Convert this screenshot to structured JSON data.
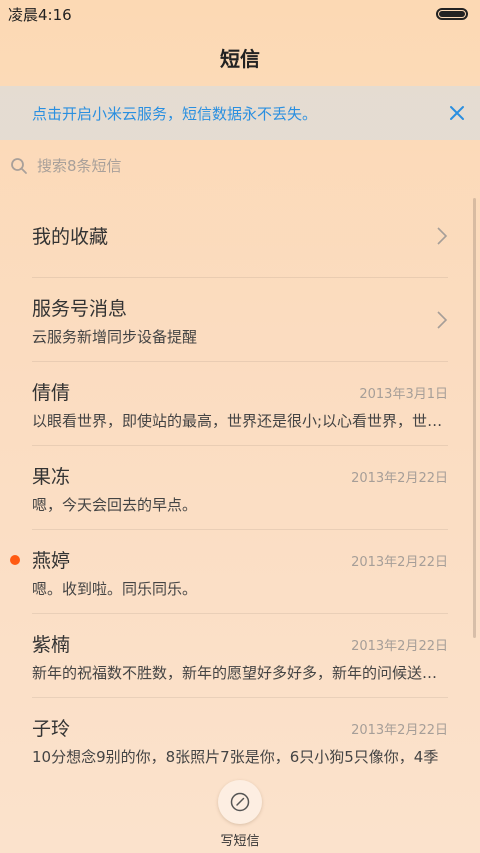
{
  "status_bar": {
    "time": "凌晨4:16",
    "battery_level": 1.0
  },
  "header": {
    "title": "短信"
  },
  "cloud_banner": {
    "text": "点击开启小米云服务，短信数据永不丢失。",
    "close_icon": "close-icon",
    "accent_color": "#2a8fe0"
  },
  "search": {
    "placeholder": "搜索8条短信",
    "icon": "search-icon"
  },
  "list": {
    "favorites": {
      "label": "我的收藏"
    },
    "service": {
      "title": "服务号消息",
      "subtitle": "云服务新增同步设备提醒"
    },
    "conversations": [
      {
        "name": "倩倩",
        "date": "2013年3月1日",
        "preview": "以眼看世界，即使站的最高，世界还是很小;以心看世界，世界还是很大",
        "unread": false
      },
      {
        "name": "果冻",
        "date": "2013年2月22日",
        "preview": "嗯，今天会回去的早点。",
        "unread": false
      },
      {
        "name": "燕婷",
        "date": "2013年2月22日",
        "preview": "嗯。收到啦。同乐同乐。",
        "unread": true
      },
      {
        "name": "紫楠",
        "date": "2013年2月22日",
        "preview": "新年的祝福数不胜数，新年的愿望好多好多，新年的问候送给你",
        "unread": false
      },
      {
        "name": "子玲",
        "date": "2013年2月22日",
        "preview": "10分想念9别的你，8张照片7张是你，6只小狗5只像你，4季",
        "unread": false
      }
    ]
  },
  "compose": {
    "label": "写短信",
    "icon": "compose-icon"
  },
  "colors": {
    "unread_dot": "#ff5a12",
    "background": "#fcd9b4"
  }
}
